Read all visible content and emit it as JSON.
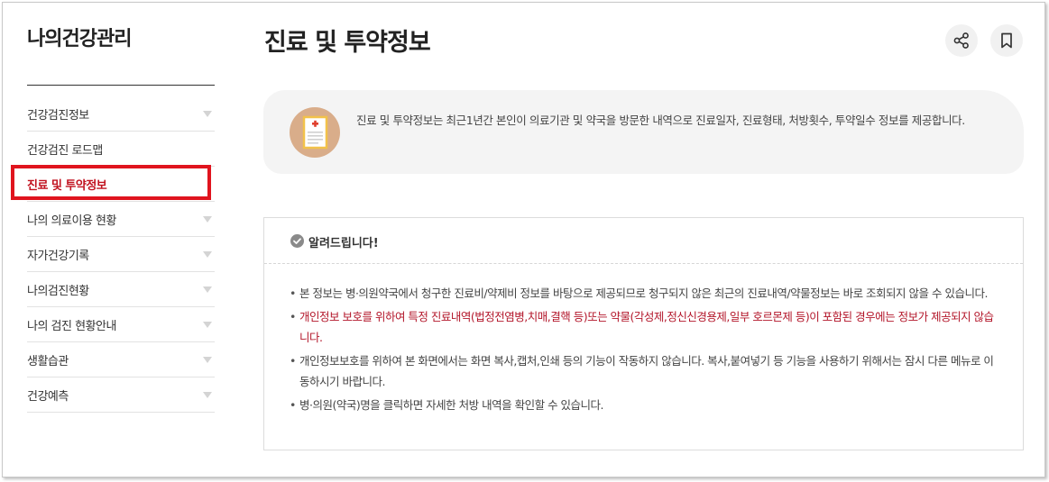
{
  "sidebar": {
    "title": "나의건강관리",
    "items": [
      {
        "label": "건강검진정보",
        "has_arrow": true
      },
      {
        "label": "건강검진 로드맵",
        "has_arrow": false
      },
      {
        "label": "진료 및 투약정보",
        "has_arrow": false,
        "active": true
      },
      {
        "label": "나의 의료이용 현황",
        "has_arrow": true
      },
      {
        "label": "자가건강기록",
        "has_arrow": true
      },
      {
        "label": "나의검진현황",
        "has_arrow": true
      },
      {
        "label": "나의 검진 현황안내",
        "has_arrow": true
      },
      {
        "label": "생활습관",
        "has_arrow": true
      },
      {
        "label": "건강예측",
        "has_arrow": true
      }
    ]
  },
  "main": {
    "title": "진료 및 투약정보",
    "info": "진료 및 투약정보는 최근1년간 본인이 의료기관 및 약국을 방문한 내역으로 진료일자, 진료형태, 처방횟수, 투약일수 정보를 제공합니다.",
    "notice": {
      "title": "알려드립니다!",
      "items": [
        {
          "text": "본 정보는 병·의원약국에서 청구한 진료비/약제비 정보를 바탕으로 제공되므로 청구되지 않은 최근의 진료내역/약물정보는 바로 조회되지 않을 수 있습니다.",
          "highlight": false
        },
        {
          "text": "개인정보 보호를 위하여 특정 진료내역(법정전염병,치매,결핵 등)또는 약물(각성제,정신신경용제,일부 호르몬제 등)이 포함된 경우에는 정보가 제공되지 않습니다.",
          "highlight": true
        },
        {
          "text": "개인정보보호를 위하여 본 화면에서는 화면 복사,캡처,인쇄 등의 기능이 작동하지 않습니다. 복사,붙여넣기 등 기능을 사용하기 위해서는 잠시 다른 메뉴로 이동하시기 바랍니다.",
          "highlight": false
        },
        {
          "text": "병·의원(약국)명을 클릭하면 자세한 처방 내역을 확인할 수 있습니다.",
          "highlight": false
        }
      ]
    }
  },
  "icons": {
    "share": "share-icon",
    "bookmark": "bookmark-icon",
    "check": "check-circle-icon",
    "document": "medical-document-icon",
    "arrow": "triangle-down-icon"
  },
  "colors": {
    "accent_red": "#e0141e",
    "highlight_text": "#b3162a",
    "info_bg": "#f4f4f4"
  }
}
